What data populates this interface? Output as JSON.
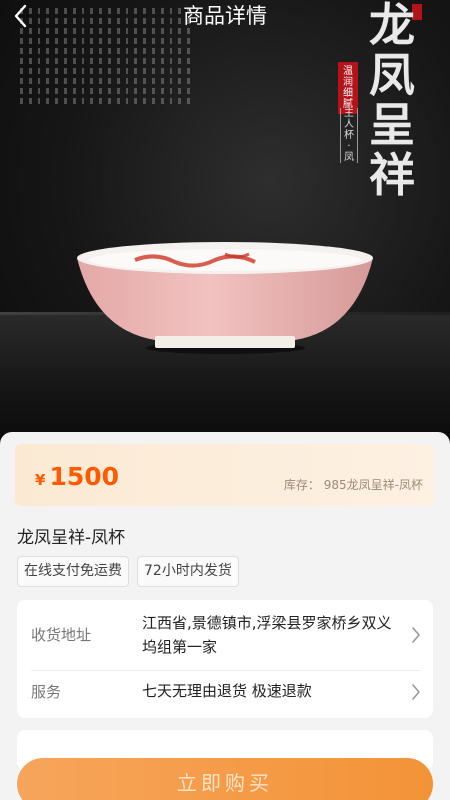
{
  "nav": {
    "title": "商品详情"
  },
  "hero": {
    "vertical_title": [
      "龙",
      "凤",
      "呈",
      "祥"
    ],
    "seal_text": [
      "温",
      "润",
      "细",
      "腻"
    ],
    "subtitle": [
      "主",
      "人",
      "杯",
      "·",
      "凤"
    ]
  },
  "product": {
    "currency": "¥",
    "price": "1500",
    "stock_label": "库存：",
    "stock_value": "985龙凤呈祥-凤杯",
    "name": "龙凤呈祥-凤杯",
    "tags": [
      "在线支付免运费",
      "72小时内发货"
    ]
  },
  "info": {
    "address_label": "收货地址",
    "address_value": "江西省,景德镇市,浮梁县罗家桥乡双义坞组第一家",
    "service_label": "服务",
    "service_value": "七天无理由退货 极速退款"
  },
  "footer": {
    "buy_label": "立即购买"
  },
  "colors": {
    "accent": "#ff5a00",
    "button": "#f59a45",
    "seal": "#b3141a"
  }
}
